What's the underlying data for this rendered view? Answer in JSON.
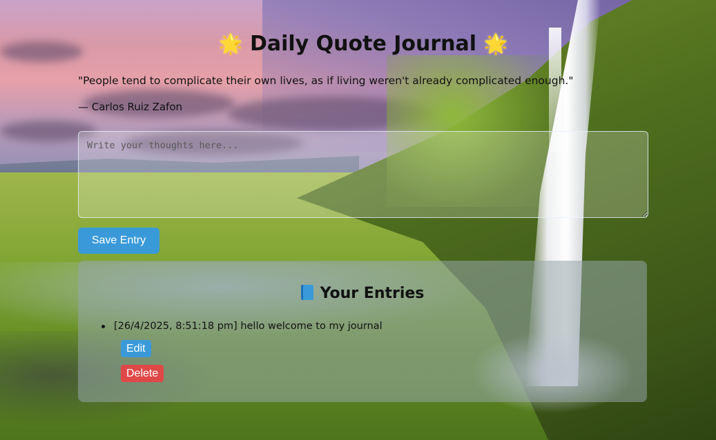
{
  "header": {
    "title": "Daily Quote Journal",
    "star_left": "🌟",
    "star_right": "🌟"
  },
  "quote": {
    "text": "\"People tend to complicate their own lives, as if living weren't already complicated enough.\"",
    "author": "— Carlos Ruiz Zafon"
  },
  "editor": {
    "placeholder": "Write your thoughts here...",
    "value": "",
    "save_label": "Save Entry"
  },
  "entries": {
    "heading": "Your Entries",
    "heading_icon": "book-icon",
    "items": [
      {
        "text": "[26/4/2025, 8:51:18 pm] hello welcome to my journal",
        "edit_label": "Edit",
        "delete_label": "Delete"
      }
    ]
  },
  "colors": {
    "primary_button": "#3a9ad9",
    "danger_button": "#e04848"
  }
}
